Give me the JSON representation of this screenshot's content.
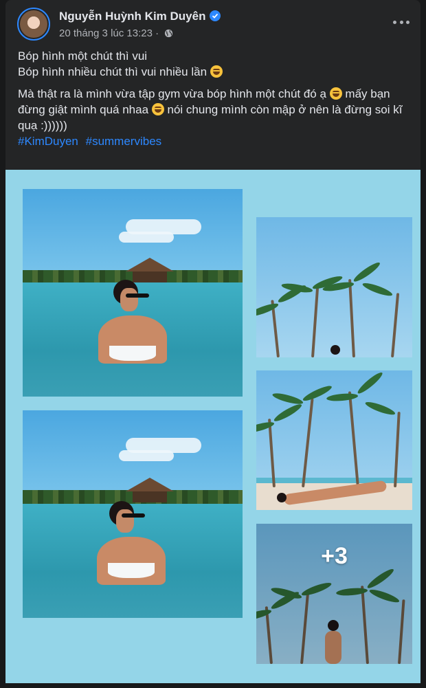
{
  "post": {
    "author": "Nguyễn Huỳnh Kim Duyên",
    "verified": true,
    "timestamp": "20 tháng 3 lúc 13:23",
    "separator": "·",
    "audience_icon": "globe-icon",
    "menu_icon": "more-options-icon",
    "text": {
      "line1": "Bóp hình một chút thì vui",
      "line2": "Bóp hình nhiều chút thì vui nhiều lần",
      "para2_part1": "Mà thật ra là mình vừa tập gym vừa bóp hình một chút đó ạ",
      "para2_part2": "mấy bạn đừng giật mình quá nhaa",
      "para2_part3": "nói chung mình còn mập ở nên là đừng soi kĩ quạ :))))))",
      "emoji_icon": "rofl-emoji-icon"
    },
    "hashtags": [
      "#KimDuyen",
      "#summervibes"
    ]
  },
  "photos": {
    "more_count_label": "+3",
    "items": [
      "pool-photo-1",
      "beach-photo-1",
      "pool-photo-2",
      "beach-photo-2",
      "beach-photo-3"
    ]
  },
  "colors": {
    "background": "#18191a",
    "card": "#242526",
    "primary_text": "#e4e6eb",
    "secondary_text": "#b0b3b8",
    "link": "#2d88ff",
    "photo_grid_bg": "#94d5e8"
  }
}
